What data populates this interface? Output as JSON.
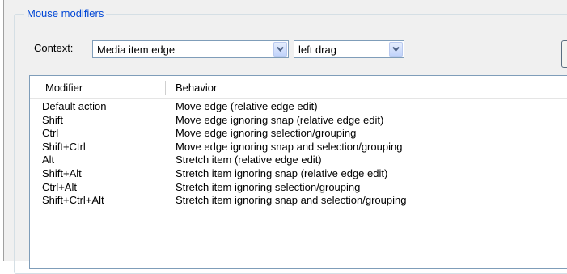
{
  "group": {
    "title": "Mouse modifiers"
  },
  "context": {
    "label": "Context:",
    "selected": "Media item edge",
    "action_selected": "left drag"
  },
  "table": {
    "columns": [
      "Modifier",
      "Behavior"
    ],
    "rows": [
      {
        "modifier": "Default action",
        "behavior": "Move edge (relative edge edit)"
      },
      {
        "modifier": "Shift",
        "behavior": "Move edge ignoring snap (relative edge edit)"
      },
      {
        "modifier": "Ctrl",
        "behavior": "Move edge ignoring selection/grouping"
      },
      {
        "modifier": "Shift+Ctrl",
        "behavior": "Move edge ignoring snap and selection/grouping"
      },
      {
        "modifier": "Alt",
        "behavior": "Stretch item (relative edge edit)"
      },
      {
        "modifier": "Shift+Alt",
        "behavior": "Stretch item ignoring snap (relative edge edit)"
      },
      {
        "modifier": "Ctrl+Alt",
        "behavior": "Stretch item ignoring selection/grouping"
      },
      {
        "modifier": "Shift+Ctrl+Alt",
        "behavior": "Stretch item ignoring snap and selection/grouping"
      }
    ]
  },
  "colors": {
    "group_title": "#0046d5",
    "panel_bg": "#f0f0f0",
    "combo_border": "#7f9db9"
  },
  "icons": {
    "dropdown": "chevron-down-icon"
  }
}
